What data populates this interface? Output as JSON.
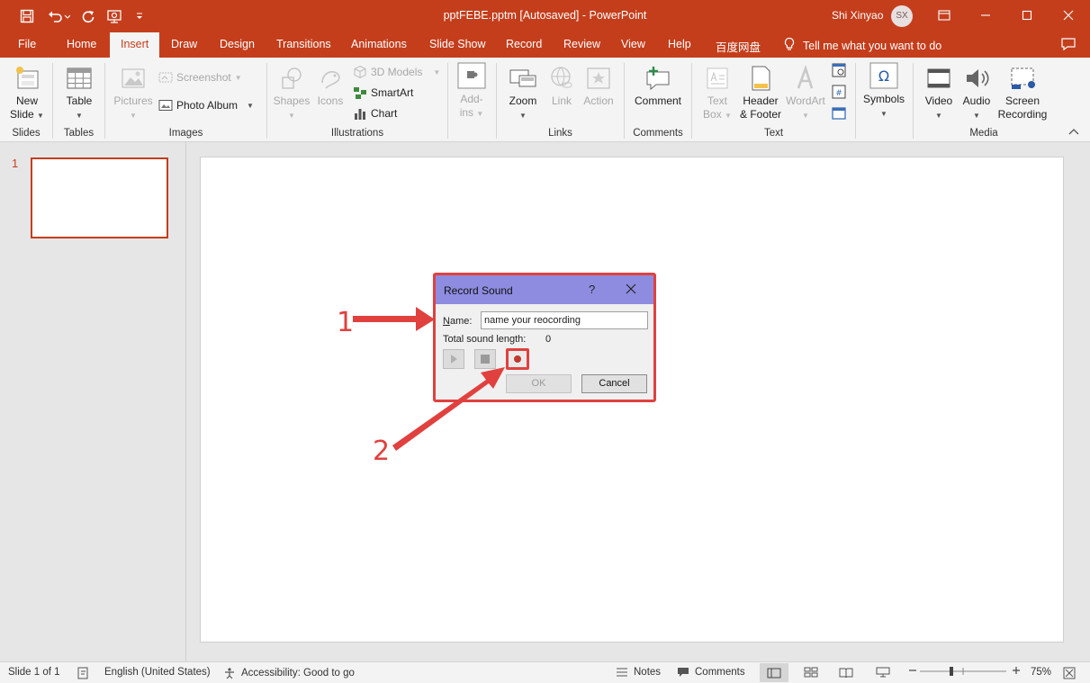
{
  "titlebar": {
    "doc_title": "pptFEBE.pptm [Autosaved]  -  PowerPoint",
    "user_name": "Shi Xinyao",
    "user_initials": "SX",
    "accent_color": "#c43e1c"
  },
  "tabs": {
    "file": "File",
    "home": "Home",
    "insert": "Insert",
    "draw": "Draw",
    "design": "Design",
    "transitions": "Transitions",
    "animations": "Animations",
    "slideshow": "Slide Show",
    "record": "Record",
    "review": "Review",
    "view": "View",
    "help": "Help",
    "baidu": "百度网盘",
    "tellme": "Tell me what you want to do"
  },
  "ribbon": {
    "new_slide_1": "New",
    "new_slide_2": "Slide",
    "table": "Table",
    "pictures": "Pictures",
    "screenshot": "Screenshot",
    "photo_album": "Photo Album",
    "shapes": "Shapes",
    "icons": "Icons",
    "models3d": "3D Models",
    "smartart": "SmartArt",
    "chart": "Chart",
    "addins_1": "Add-",
    "addins_2": "ins",
    "zoom": "Zoom",
    "link": "Link",
    "action": "Action",
    "comment": "Comment",
    "textbox_1": "Text",
    "textbox_2": "Box",
    "header_1": "Header",
    "header_2": "& Footer",
    "wordart": "WordArt",
    "symbols": "Symbols",
    "video": "Video",
    "audio": "Audio",
    "screenrec_1": "Screen",
    "screenrec_2": "Recording",
    "groups": {
      "slides": "Slides",
      "tables": "Tables",
      "images": "Images",
      "illustrations": "Illustrations",
      "links": "Links",
      "comments": "Comments",
      "text": "Text",
      "media": "Media"
    }
  },
  "thumbs": {
    "slide_number": "1"
  },
  "dialog": {
    "title": "Record Sound",
    "help": "?",
    "name_label_u": "N",
    "name_label_rest": "ame:",
    "name_value": "name your reocording",
    "length_label": "Total sound length:",
    "length_value": "0",
    "ok": "OK",
    "cancel": "Cancel"
  },
  "annotations": {
    "step1": "1",
    "step2": "2",
    "color": "#e0413f"
  },
  "status": {
    "slide": "Slide 1 of 1",
    "language": "English (United States)",
    "accessibility": "Accessibility: Good to go",
    "notes": "Notes",
    "comments": "Comments",
    "zoom": "75%"
  }
}
